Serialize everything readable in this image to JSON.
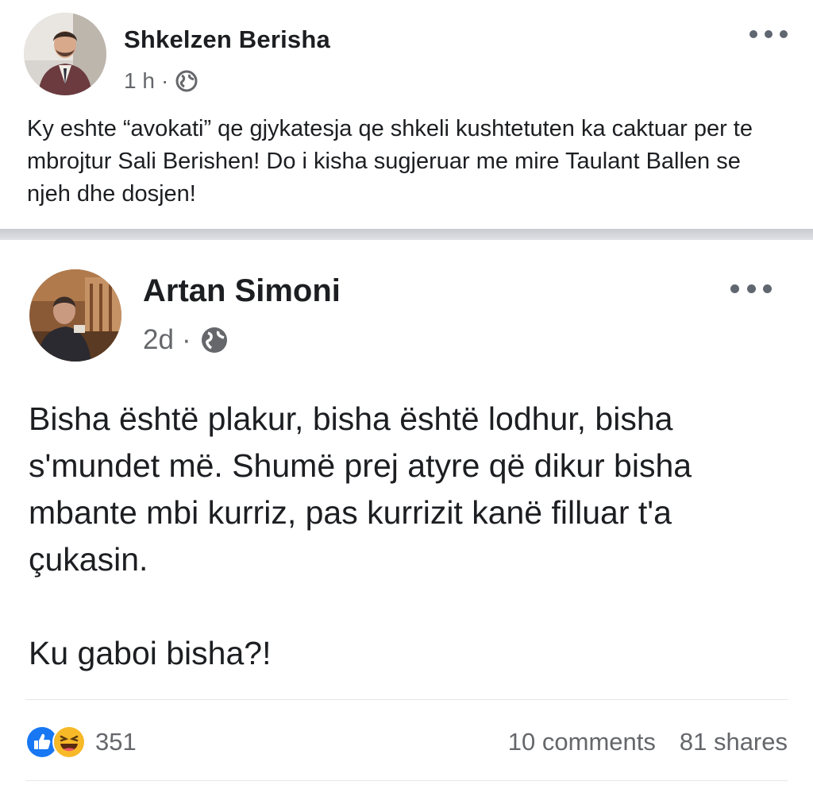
{
  "post": {
    "author": "Shkelzen Berisha",
    "time": "1 h",
    "separator": "·",
    "privacy_icon": "globe-icon",
    "more_icon": "more-options-icon",
    "text": "Ky eshte “avokati” qe gjykatesja qe shkeli kushtetuten ka caktuar per te mbrojtur Sali Berishen! Do i kisha sugjeruar me mire Taulant Ballen se njeh dhe dosjen!"
  },
  "shared_post": {
    "author": "Artan Simoni",
    "time": "2d",
    "separator": "·",
    "privacy_icon": "globe-icon",
    "more_icon": "more-options-icon",
    "paragraph1": "Bisha është plakur, bisha është lodhur, bisha s'mundet më. Shumë prej atyre që dikur bisha mbante mbi kurriz, pas kurrizit kanë filluar t'a çukasin.",
    "paragraph2": "Ku gaboi bisha?!"
  },
  "footer": {
    "reaction_icons": [
      "like-reaction-icon",
      "haha-reaction-icon"
    ],
    "reaction_count": "351",
    "comments": "10 comments",
    "shares": "81 shares"
  },
  "colors": {
    "text_primary": "#1c1e21",
    "text_secondary": "#65676b",
    "like_blue": "#1877f2",
    "haha_yellow": "#f7b928",
    "divider": "#c9cbd0"
  }
}
